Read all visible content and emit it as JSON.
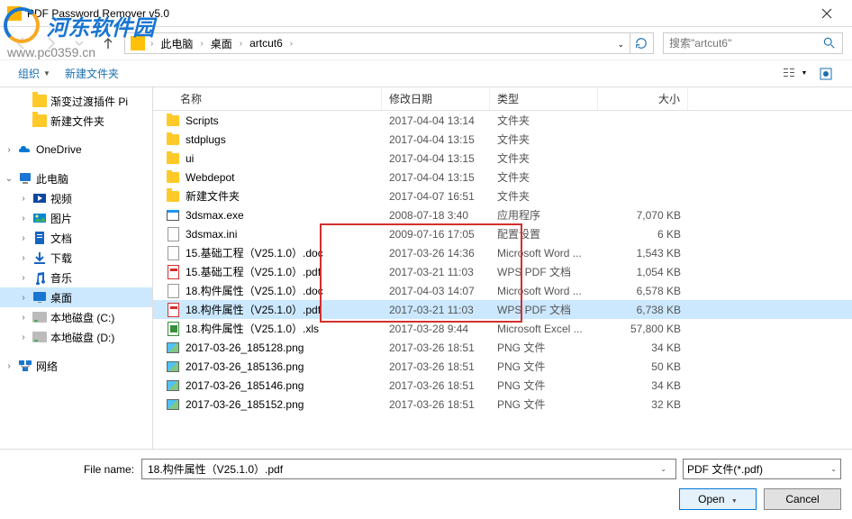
{
  "window": {
    "title": "PDF Password Remover v5.0"
  },
  "watermark": {
    "text": "河东软件园",
    "url": "www.pc0359.cn"
  },
  "nav": {
    "breadcrumb": [
      "此电脑",
      "桌面",
      "artcut6"
    ],
    "search_placeholder": "搜索\"artcut6\""
  },
  "toolbar": {
    "organize": "组织",
    "new_folder": "新建文件夹"
  },
  "sidebar": {
    "items": [
      {
        "label": "渐变过渡插件 Pi",
        "icon": "folder",
        "indent": 1
      },
      {
        "label": "新建文件夹",
        "icon": "folder",
        "indent": 1
      },
      {
        "label": "OneDrive",
        "icon": "onedrive",
        "indent": 0,
        "arrow": ">"
      },
      {
        "label": "此电脑",
        "icon": "pc",
        "indent": 0,
        "arrow": "v"
      },
      {
        "label": "视频",
        "icon": "video",
        "indent": 1,
        "arrow": ">"
      },
      {
        "label": "图片",
        "icon": "pictures",
        "indent": 1,
        "arrow": ">"
      },
      {
        "label": "文档",
        "icon": "documents",
        "indent": 1,
        "arrow": ">"
      },
      {
        "label": "下载",
        "icon": "downloads",
        "indent": 1,
        "arrow": ">"
      },
      {
        "label": "音乐",
        "icon": "music",
        "indent": 1,
        "arrow": ">"
      },
      {
        "label": "桌面",
        "icon": "desktop",
        "indent": 1,
        "arrow": ">",
        "selected": true
      },
      {
        "label": "本地磁盘 (C:)",
        "icon": "drive",
        "indent": 1,
        "arrow": ">"
      },
      {
        "label": "本地磁盘 (D:)",
        "icon": "drive",
        "indent": 1,
        "arrow": ">"
      },
      {
        "label": "网络",
        "icon": "network",
        "indent": 0,
        "arrow": ">"
      }
    ]
  },
  "columns": {
    "name": "名称",
    "date": "修改日期",
    "type": "类型",
    "size": "大小"
  },
  "files": [
    {
      "name": "Scripts",
      "date": "2017-04-04 13:14",
      "type": "文件夹",
      "size": "",
      "icon": "folder"
    },
    {
      "name": "stdplugs",
      "date": "2017-04-04 13:15",
      "type": "文件夹",
      "size": "",
      "icon": "folder"
    },
    {
      "name": "ui",
      "date": "2017-04-04 13:15",
      "type": "文件夹",
      "size": "",
      "icon": "folder"
    },
    {
      "name": "Webdepot",
      "date": "2017-04-04 13:15",
      "type": "文件夹",
      "size": "",
      "icon": "folder"
    },
    {
      "name": "新建文件夹",
      "date": "2017-04-07 16:51",
      "type": "文件夹",
      "size": "",
      "icon": "folder"
    },
    {
      "name": "3dsmax.exe",
      "date": "2008-07-18 3:40",
      "type": "应用程序",
      "size": "7,070 KB",
      "icon": "exe"
    },
    {
      "name": "3dsmax.ini",
      "date": "2009-07-16 17:05",
      "type": "配置设置",
      "size": "6 KB",
      "icon": "ini"
    },
    {
      "name": "15.基础工程（V25.1.0）.doc",
      "date": "2017-03-26 14:36",
      "type": "Microsoft Word ...",
      "size": "1,543 KB",
      "icon": "doc"
    },
    {
      "name": "15.基础工程（V25.1.0）.pdf",
      "date": "2017-03-21 11:03",
      "type": "WPS PDF 文档",
      "size": "1,054 KB",
      "icon": "pdf"
    },
    {
      "name": "18.构件属性（V25.1.0）.doc",
      "date": "2017-04-03 14:07",
      "type": "Microsoft Word ...",
      "size": "6,578 KB",
      "icon": "doc"
    },
    {
      "name": "18.构件属性（V25.1.0）.pdf",
      "date": "2017-03-21 11:03",
      "type": "WPS PDF 文档",
      "size": "6,738 KB",
      "icon": "pdf",
      "selected": true
    },
    {
      "name": "18.构件属性（V25.1.0）.xls",
      "date": "2017-03-28 9:44",
      "type": "Microsoft Excel ...",
      "size": "57,800 KB",
      "icon": "xls"
    },
    {
      "name": "2017-03-26_185128.png",
      "date": "2017-03-26 18:51",
      "type": "PNG 文件",
      "size": "34 KB",
      "icon": "png"
    },
    {
      "name": "2017-03-26_185136.png",
      "date": "2017-03-26 18:51",
      "type": "PNG 文件",
      "size": "50 KB",
      "icon": "png"
    },
    {
      "name": "2017-03-26_185146.png",
      "date": "2017-03-26 18:51",
      "type": "PNG 文件",
      "size": "34 KB",
      "icon": "png"
    },
    {
      "name": "2017-03-26_185152.png",
      "date": "2017-03-26 18:51",
      "type": "PNG 文件",
      "size": "32 KB",
      "icon": "png"
    }
  ],
  "bottom": {
    "filename_label": "File name:",
    "filename_value": "18.构件属性（V25.1.0）.pdf",
    "filetype": "PDF 文件(*.pdf)",
    "open": "Open",
    "cancel": "Cancel"
  }
}
